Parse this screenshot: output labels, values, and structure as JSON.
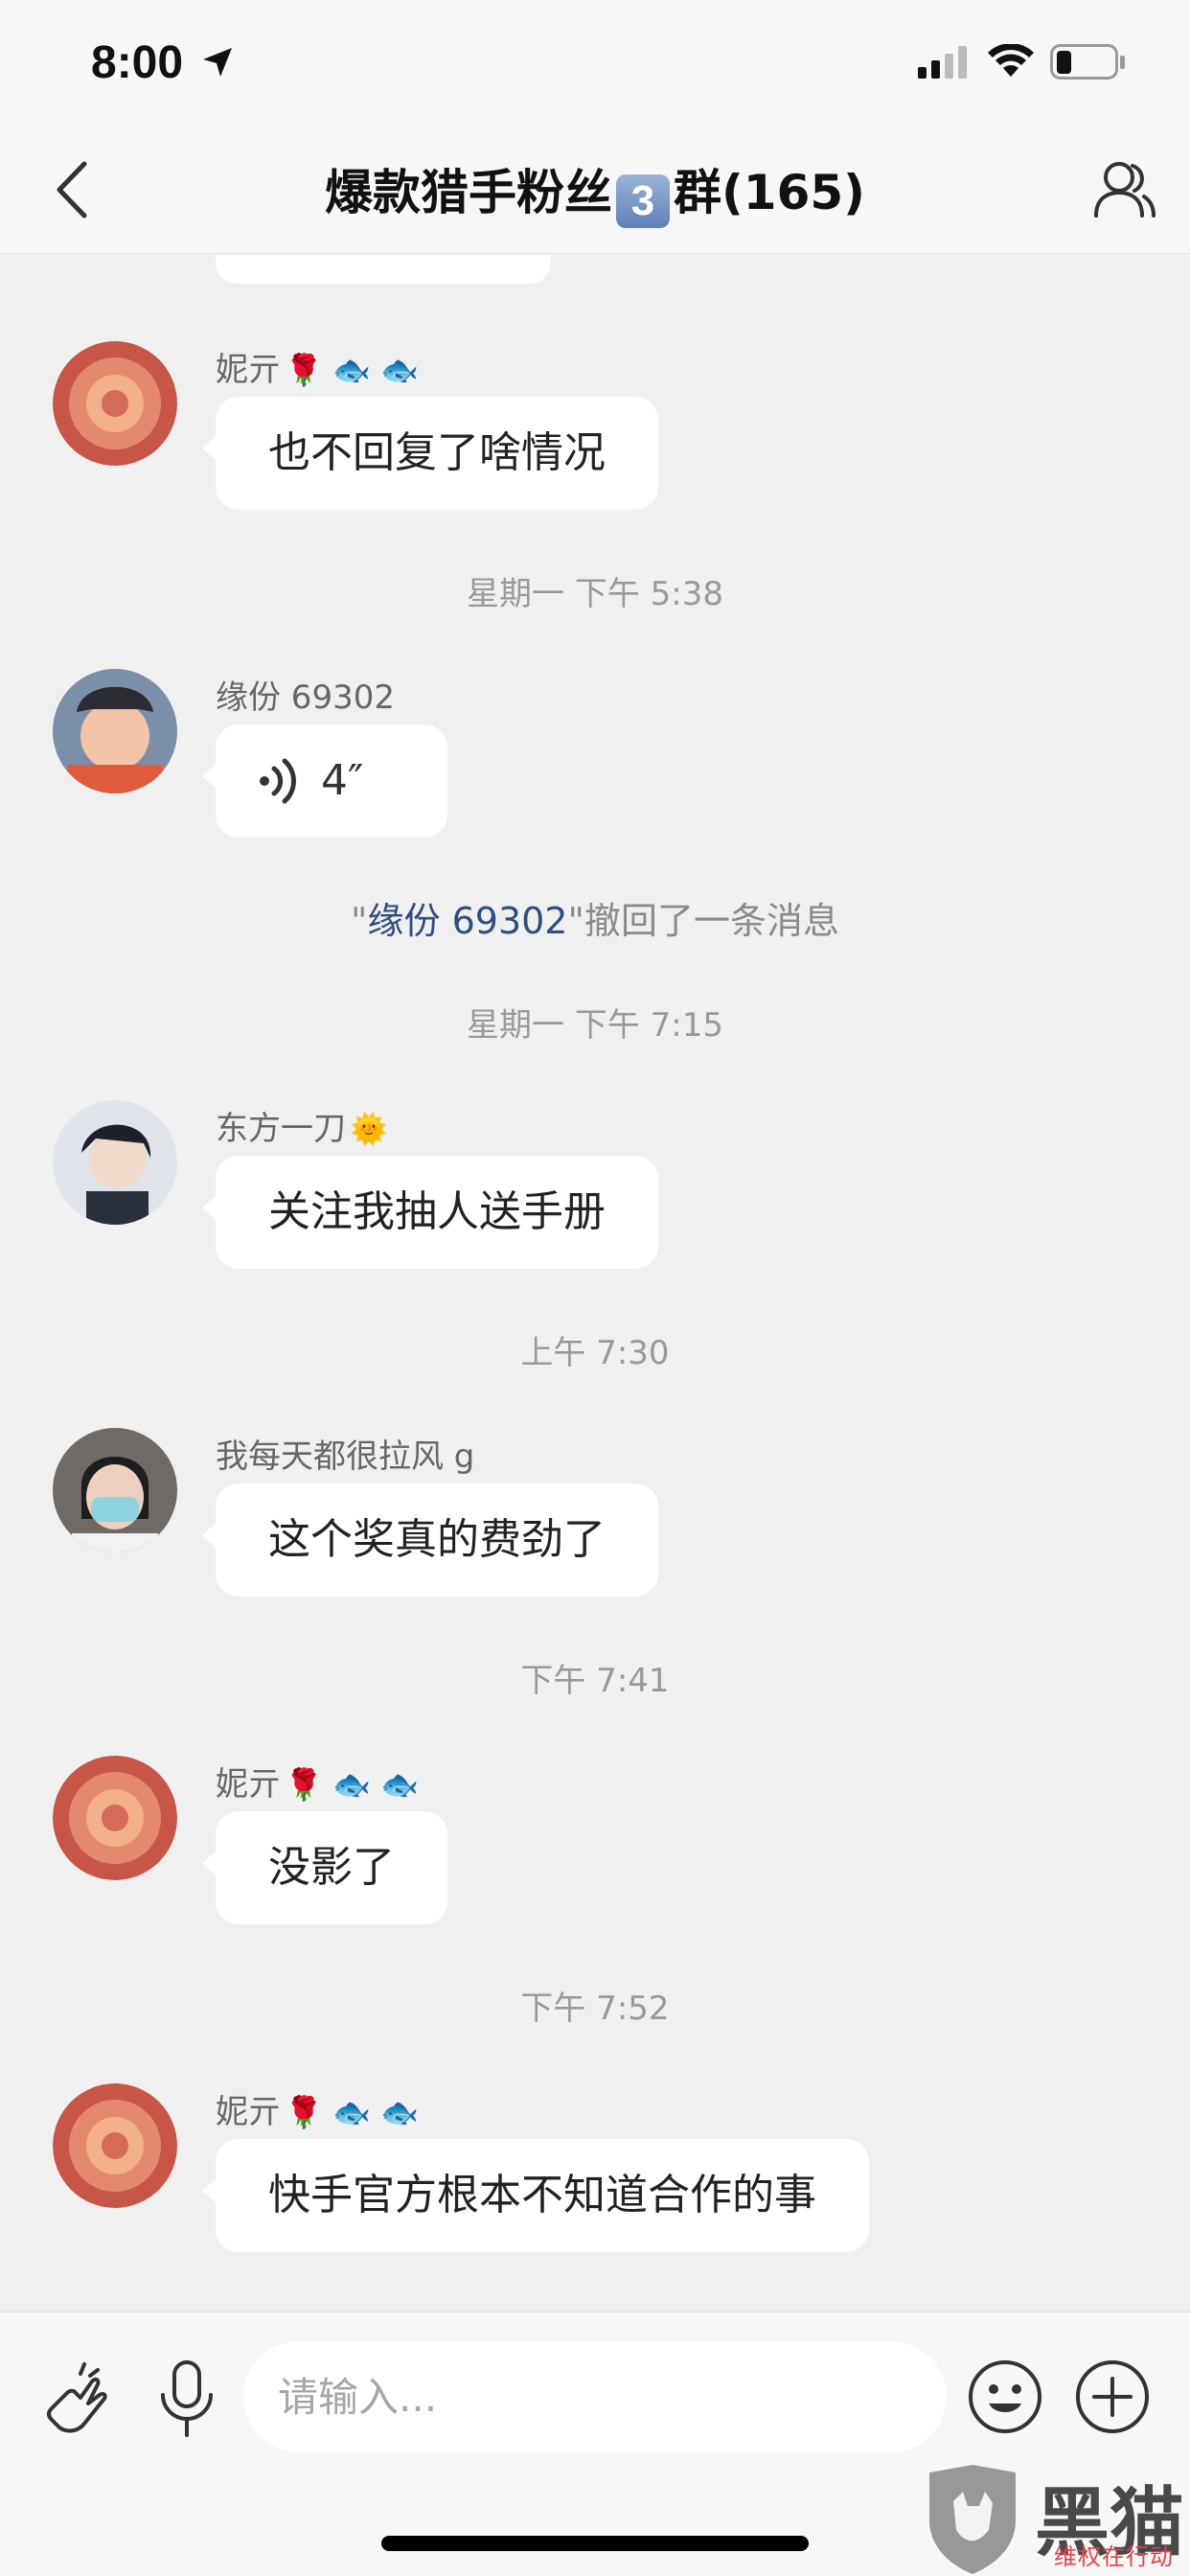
{
  "status_bar": {
    "time": "8:00"
  },
  "header": {
    "title_prefix": "爆款猎手粉丝",
    "title_badge": "3",
    "title_suffix": "群(165)"
  },
  "messages": [
    {
      "sender": "妮亓",
      "sender_emoji": "🌹 🐟 🐟",
      "text": "也不回复了啥情况"
    },
    {
      "sender": "缘份 69302",
      "voice_duration": "4″"
    },
    {
      "sender": "东方一刀",
      "sender_emoji": "🌞",
      "text": "关注我抽人送手册"
    },
    {
      "sender": "我每天都很拉风 g",
      "text": "这个奖真的费劲了"
    },
    {
      "sender": "妮亓",
      "sender_emoji": "🌹 🐟 🐟",
      "text": "没影了"
    },
    {
      "sender": "妮亓",
      "sender_emoji": "🌹 🐟 🐟",
      "text": "快手官方根本不知道合作的事"
    }
  ],
  "timestamps": [
    "星期一 下午 5:38",
    "星期一 下午 7:15",
    "上午 7:30",
    "下午 7:41",
    "下午 7:52"
  ],
  "system_message": {
    "quote_open": "\"",
    "name": "缘份 69302",
    "rest": "\"撤回了一条消息"
  },
  "input": {
    "placeholder": "请输入..."
  },
  "watermark": {
    "title": "黑猫",
    "subtitle": "维权在行动"
  },
  "colors": {
    "background": "#f0f0f0",
    "bubble": "#ffffff",
    "link_name": "#2e4d80"
  }
}
